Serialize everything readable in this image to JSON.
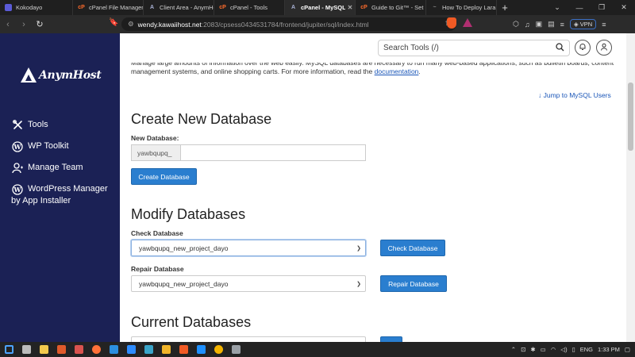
{
  "browser": {
    "tabs": [
      {
        "title": "Kokodayo",
        "favicon_color": "#5b5bd6",
        "favicon_glyph": ""
      },
      {
        "title": "cPanel File Manager",
        "favicon_color": "#ff6c2c",
        "favicon_glyph": "cP"
      },
      {
        "title": "Client Area - AnymHost",
        "favicon_color": "#aab3d6",
        "favicon_glyph": "A"
      },
      {
        "title": "cPanel - Tools",
        "favicon_color": "#ff6c2c",
        "favicon_glyph": "cP"
      },
      {
        "title": "cPanel - MySQL",
        "favicon_color": "#aab3d6",
        "favicon_glyph": "A"
      },
      {
        "title": "Guide to Git™ - Set",
        "favicon_color": "#ff6c2c",
        "favicon_glyph": "cP"
      },
      {
        "title": "How To Deploy Lara",
        "favicon_color": "#888888",
        "favicon_glyph": "~"
      }
    ],
    "active_tab": 4,
    "url_host": "wendy.kawaiihost.net",
    "url_path": ":2083/cpsess0434531784/frontend/jupiter/sql/index.html",
    "vpn_label": "VPN"
  },
  "sidebar": {
    "brand": "AnymHost",
    "items": [
      {
        "label": "Tools",
        "icon": "tools-icon"
      },
      {
        "label": "WP Toolkit",
        "icon": "wordpress-icon"
      },
      {
        "label": "Manage Team",
        "icon": "manage-team-icon"
      },
      {
        "label": "WordPress Manager by App Installer",
        "icon": "wordpress-icon"
      }
    ]
  },
  "topbar": {
    "search_placeholder": "Search Tools (/)"
  },
  "main": {
    "intro_text": "Manage large amounts of information over the web easily. MySQL databases are necessary to run many web-based applications, such as bulletin boards, content management systems, and online shopping carts. For more information, read the ",
    "intro_link": "documentation",
    "intro_end": ".",
    "jump_link": "Jump to MySQL Users",
    "create": {
      "title": "Create New Database",
      "label": "New Database:",
      "prefix": "yawbqupq_",
      "value": "",
      "button": "Create Database"
    },
    "modify": {
      "title": "Modify Databases",
      "check_label": "Check Database",
      "check_selected": "yawbqupq_new_project_dayo",
      "check_button": "Check Database",
      "repair_label": "Repair Database",
      "repair_selected": "yawbqupq_new_project_dayo",
      "repair_button": "Repair Database"
    },
    "current": {
      "title": "Current Databases"
    }
  },
  "taskbar": {
    "language": "ENG",
    "time": "1:33 PM",
    "apps": [
      {
        "icon": "windows-start-icon",
        "color": "#4da3ff"
      },
      {
        "icon": "task-view-icon",
        "color": "#bbbbbb"
      },
      {
        "icon": "file-explorer-icon",
        "color": "#f2c94c"
      },
      {
        "icon": "app-icon",
        "color": "#e05a2b"
      },
      {
        "icon": "app-icon",
        "color": "#d9534f"
      },
      {
        "icon": "firefox-icon",
        "color": "#ff7139"
      },
      {
        "icon": "vscode-icon",
        "color": "#2c8fe0"
      },
      {
        "icon": "zoom-icon",
        "color": "#2d8cff"
      },
      {
        "icon": "app-icon",
        "color": "#3aa5c9"
      },
      {
        "icon": "file-explorer-icon",
        "color": "#f0b429"
      },
      {
        "icon": "brave-icon",
        "color": "#f15a24"
      },
      {
        "icon": "app-icon",
        "color": "#1e90ff"
      },
      {
        "icon": "chrome-icon",
        "color": "#f4b400"
      },
      {
        "icon": "app-icon",
        "color": "#9aa0a6"
      }
    ]
  }
}
